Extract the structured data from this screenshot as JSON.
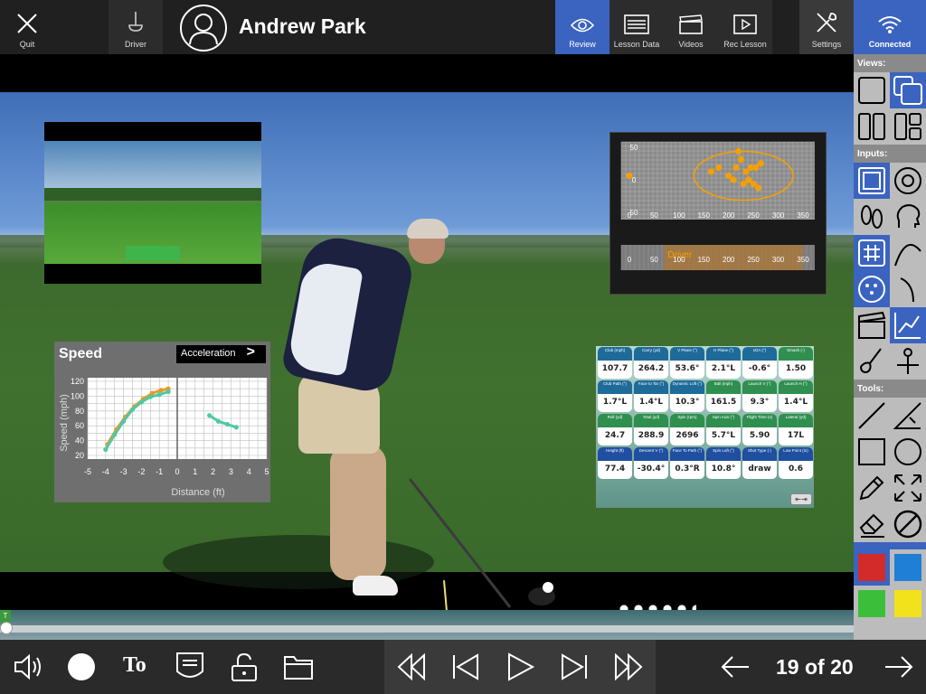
{
  "topbar": {
    "quit_label": "Quit",
    "driver_label": "Driver",
    "player_name": "Andrew Park",
    "review_label": "Review",
    "lesson_data_label": "Lesson Data",
    "videos_label": "Videos",
    "rec_lesson_label": "Rec Lesson",
    "settings_label": "Settings",
    "connected_label": "Connected"
  },
  "speed_graph": {
    "title": "Speed",
    "accel_label": "Acceleration",
    "accel_arrow": ">",
    "ylabel": "Speed (mph)",
    "xlabel": "Distance (ft)",
    "y_ticks": [
      "120",
      "100",
      "80",
      "60",
      "40",
      "20"
    ],
    "x_ticks": [
      "-5",
      "-4",
      "-3",
      "-2",
      "-1",
      "0",
      "1",
      "2",
      "3",
      "4",
      "5"
    ]
  },
  "chart_data": [
    {
      "type": "scatter",
      "title": "Speed",
      "xlabel": "Distance (ft)",
      "ylabel": "Speed (mph)",
      "xlim": [
        -5,
        5
      ],
      "ylim": [
        20,
        120
      ],
      "series": [
        {
          "name": "",
          "color": "#e69a2a",
          "x": [
            -3.9,
            -3.4,
            -2.9,
            -2.4,
            -1.9,
            -1.4,
            -0.9,
            -0.5
          ],
          "y": [
            35,
            55,
            72,
            86,
            96,
            104,
            108,
            110
          ]
        },
        {
          "name": "",
          "color": "#4fc8a4",
          "x": [
            -4.0,
            -3.5,
            -3.0,
            -2.5,
            -2.0,
            -1.5,
            -1.0,
            -0.5,
            1.8,
            2.3,
            2.8,
            3.3
          ],
          "y": [
            28,
            48,
            66,
            82,
            92,
            99,
            102,
            106,
            74,
            66,
            62,
            58
          ]
        }
      ],
      "grid": true
    },
    {
      "type": "scatter",
      "x_ticks": [
        "0",
        "50",
        "100",
        "150",
        "200",
        "250",
        "300",
        "350"
      ],
      "y_ticks": [
        "50",
        "0",
        "50"
      ],
      "carry_label": "Driver",
      "carry_range": [
        70,
        350
      ],
      "series": [
        {
          "name": "",
          "color": "#f5a000",
          "x": [
            0,
            165,
            180,
            200,
            215,
            225,
            235,
            245,
            255,
            265,
            210,
            230,
            240,
            250,
            260,
            220
          ],
          "y": [
            5,
            10,
            15,
            5,
            15,
            25,
            10,
            15,
            15,
            20,
            0,
            -5,
            0,
            -5,
            -10,
            35
          ]
        }
      ],
      "ellipse": {
        "center_x": 230,
        "center_y": 5,
        "radius_x": 100,
        "radius_y": 30
      },
      "grid": true
    }
  ],
  "metrics": [
    {
      "label": "Club (mph)",
      "value": "107.7",
      "color": "#1e6b9a"
    },
    {
      "label": "Carry (yd)",
      "value": "264.2",
      "color": "#1e6b9a"
    },
    {
      "label": "V Plane (°)",
      "value": "53.6°",
      "color": "#1e6b9a"
    },
    {
      "label": "H Plane (°)",
      "value": "2.1°L",
      "color": "#1e6b9a"
    },
    {
      "label": "sGA (°)",
      "value": "-0.6°",
      "color": "#1e6b9a"
    },
    {
      "label": "Smash (-)",
      "value": "1.50",
      "color": "#2f8f4f"
    },
    {
      "label": "Club Path (°)",
      "value": "1.7°L",
      "color": "#1e6b9a"
    },
    {
      "label": "Face to Tar (°)",
      "value": "1.4°L",
      "color": "#1e6b9a"
    },
    {
      "label": "Dynamic Loft (°)",
      "value": "10.3°",
      "color": "#1e6b9a"
    },
    {
      "label": "Ball (mph)",
      "value": "161.5",
      "color": "#2f8f4f"
    },
    {
      "label": "Launch V (°)",
      "value": "9.3°",
      "color": "#2f8f4f"
    },
    {
      "label": "Launch H (°)",
      "value": "1.4°L",
      "color": "#2f8f4f"
    },
    {
      "label": "Roll (yd)",
      "value": "24.7",
      "color": "#2f8f4f"
    },
    {
      "label": "Total (yd)",
      "value": "288.9",
      "color": "#2f8f4f"
    },
    {
      "label": "Spin (rpm)",
      "value": "2696",
      "color": "#2f8f4f"
    },
    {
      "label": "Spin Axis (°)",
      "value": "5.7°L",
      "color": "#2f8f4f"
    },
    {
      "label": "Flight Time (s)",
      "value": "5.90",
      "color": "#2f8f4f"
    },
    {
      "label": "Lateral (yd)",
      "value": "17L",
      "color": "#2f8f4f"
    },
    {
      "label": "Height (ft)",
      "value": "77.4",
      "color": "#1e4fa0"
    },
    {
      "label": "Descent V (°)",
      "value": "-30.4°",
      "color": "#1e4fa0"
    },
    {
      "label": "Face To Path (°)",
      "value": "0.3°R",
      "color": "#1e4fa0"
    },
    {
      "label": "Spin Loft (°)",
      "value": "10.8°",
      "color": "#1e4fa0"
    },
    {
      "label": "Shot Type (-)",
      "value": "draw",
      "color": "#1e4fa0"
    },
    {
      "label": "Low Point (in)",
      "value": "0.6",
      "color": "#1e4fa0"
    }
  ],
  "right_panel": {
    "views_label": "Views:",
    "inputs_label": "Inputs:",
    "tools_label": "Tools:",
    "colors": [
      "#d32a2a",
      "#1f7fd6",
      "#3bbf3b",
      "#f2e21b"
    ]
  },
  "timeline": {
    "marker_label": "T"
  },
  "bottombar": {
    "text_tool_label": "To",
    "page_count": "19 of 20"
  }
}
